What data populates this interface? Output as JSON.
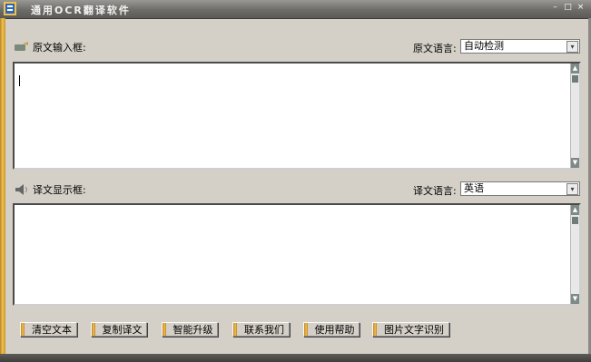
{
  "window": {
    "title": "通用OCR翻译软件",
    "buttons": [
      "–",
      "□",
      "×"
    ]
  },
  "source": {
    "label": "原文输入框:",
    "lang_label": "原文语言:",
    "lang_value": "自动检测",
    "text": ""
  },
  "target": {
    "label": "译文显示框:",
    "lang_label": "译文语言:",
    "lang_value": "英语",
    "text": ""
  },
  "toolbar": {
    "clear": "清空文本",
    "copy": "复制译文",
    "upgrade": "智能升级",
    "contact": "联系我们",
    "help": "使用帮助",
    "ocr": "图片文字识别"
  },
  "icons": {
    "app": "app-icon",
    "source_label": "pencil-icon",
    "target_label": "speaker-icon",
    "dropdown": "chevron-down-icon",
    "scroll_up": "arrow-up-icon",
    "scroll_down": "arrow-down-icon"
  }
}
